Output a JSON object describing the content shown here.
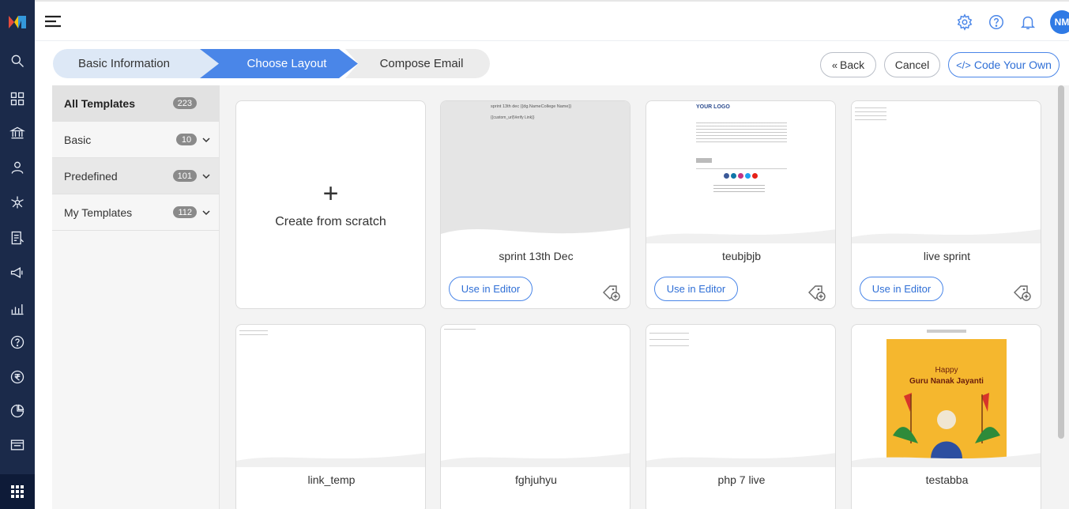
{
  "stepper": {
    "steps": [
      "Basic Information",
      "Choose Layout",
      "Compose Email"
    ],
    "active": 1
  },
  "header_buttons": {
    "back": "Back",
    "cancel": "Cancel",
    "code_your_own": "Code Your Own"
  },
  "user": {
    "initials": "NM"
  },
  "sidebar": {
    "items": [
      {
        "label": "All Templates",
        "count": "223"
      },
      {
        "label": "Basic",
        "count": "10"
      },
      {
        "label": "Predefined",
        "count": "101"
      },
      {
        "label": "My Templates",
        "count": "112"
      }
    ]
  },
  "scratch": {
    "label": "Create from scratch",
    "plus": "+"
  },
  "templates": [
    {
      "name": "sprint 13th Dec",
      "preview_line1": "sprint 13th dec {{dg.NameCollege Name}}",
      "preview_line2": "{{custom_url|Verify Link}}"
    },
    {
      "name": "teubjbjb",
      "preview_logo": "YOUR LOGO"
    },
    {
      "name": "live sprint"
    },
    {
      "name": "link_temp"
    },
    {
      "name": "fghjuhyu"
    },
    {
      "name": "php 7 live"
    },
    {
      "name": "testabba",
      "poster_text1": "Happy",
      "poster_text2": "Guru Nanak Jayanti"
    }
  ],
  "use_in_editor_label": "Use in Editor",
  "colors": {
    "rail": "#1b2a4a",
    "accent": "#4a86e8",
    "step_active": "#4a86e8",
    "poster": "#f5b72e"
  }
}
